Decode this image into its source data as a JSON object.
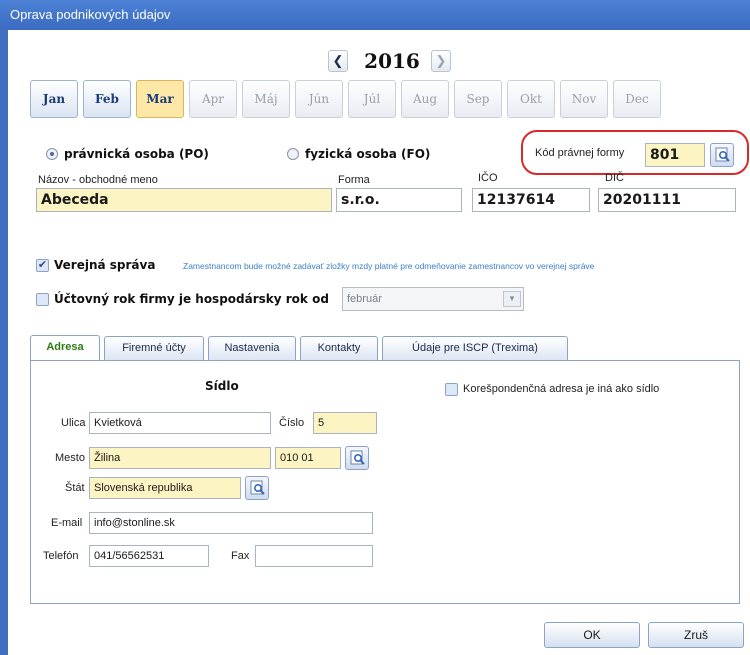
{
  "window": {
    "title": "Oprava podnikových údajov"
  },
  "year_nav": {
    "prev": "❮",
    "year": "2016",
    "next": "❯"
  },
  "months": [
    "Jan",
    "Feb",
    "Mar",
    "Apr",
    "Máj",
    "Jún",
    "Júl",
    "Aug",
    "Sep",
    "Okt",
    "Nov",
    "Dec"
  ],
  "selected_month": "Mar",
  "entity_type": {
    "legal_label": "právnická osoba (PO)",
    "natural_label": "fyzická osoba (FO)",
    "selected": "legal"
  },
  "legal_form_code": {
    "label": "Kód právnej formy",
    "value": "801"
  },
  "company": {
    "name_label": "Názov - obchodné meno",
    "name_value": "Abeceda",
    "form_label": "Forma",
    "form_value": "s.r.o.",
    "ico_label": "IČO",
    "ico_value": "12137614",
    "dic_label": "DIČ",
    "dic_value": "20201111"
  },
  "public_admin": {
    "label": "Verejná správa",
    "checked": true,
    "note": "Zamestnancom bude možné zadávať zložky mzdy platné pre odmeňovanie zamestnancov vo verejnej správe"
  },
  "fiscal_year": {
    "label": "Účtovný rok firmy je hospodársky rok od",
    "checked": false,
    "month_value": "február"
  },
  "tabs": [
    "Adresa",
    "Firemné účty",
    "Nastavenia",
    "Kontakty",
    "Údaje pre ISCP (Trexima)"
  ],
  "address": {
    "section_title": "Sídlo",
    "corr_label": "Korešpondenčná adresa je iná ako sídlo",
    "street_label": "Ulica",
    "street_value": "Kvietková",
    "number_label": "Číslo",
    "number_value": "5",
    "city_label": "Mesto",
    "city_value": "Žilina",
    "zip_value": "010 01",
    "country_label": "Štát",
    "country_value": "Slovenská republika",
    "email_label": "E-mail",
    "email_value": "info@stonline.sk",
    "phone_label": "Telefón",
    "phone_value": "041/56562531",
    "fax_label": "Fax",
    "fax_value": ""
  },
  "buttons": {
    "ok": "OK",
    "cancel": "Zruš"
  },
  "colors": {
    "accent": "#3e6fc0",
    "highlight": "#fde7a6",
    "required_field": "#fdf4c4",
    "annotation": "#d42a2a"
  }
}
